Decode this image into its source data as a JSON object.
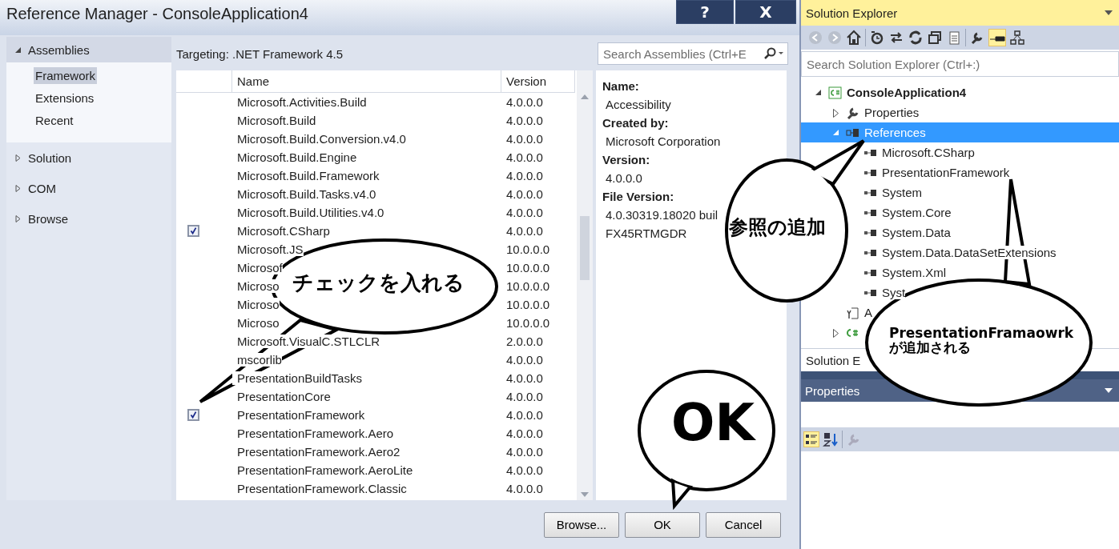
{
  "dialog": {
    "title": "Reference Manager - ConsoleApplication4",
    "title_buttons": [
      "?",
      "X"
    ],
    "nav": [
      {
        "label": "Assemblies",
        "expanded": true,
        "children": [
          {
            "label": "Framework",
            "selected": true
          },
          {
            "label": "Extensions",
            "selected": false
          },
          {
            "label": "Recent",
            "selected": false
          }
        ]
      },
      {
        "label": "Solution",
        "expanded": false
      },
      {
        "label": "COM",
        "expanded": false
      },
      {
        "label": "Browse",
        "expanded": false
      }
    ],
    "targeting": "Targeting: .NET Framework 4.5",
    "search": {
      "placeholder": "Search Assemblies (Ctrl+E"
    },
    "columns": [
      "Name",
      "Version"
    ],
    "rows": [
      {
        "name": "Microsoft.Activities.Build",
        "version": "4.0.0.0",
        "checked": false
      },
      {
        "name": "Microsoft.Build",
        "version": "4.0.0.0",
        "checked": false
      },
      {
        "name": "Microsoft.Build.Conversion.v4.0",
        "version": "4.0.0.0",
        "checked": false
      },
      {
        "name": "Microsoft.Build.Engine",
        "version": "4.0.0.0",
        "checked": false
      },
      {
        "name": "Microsoft.Build.Framework",
        "version": "4.0.0.0",
        "checked": false
      },
      {
        "name": "Microsoft.Build.Tasks.v4.0",
        "version": "4.0.0.0",
        "checked": false
      },
      {
        "name": "Microsoft.Build.Utilities.v4.0",
        "version": "4.0.0.0",
        "checked": false
      },
      {
        "name": "Microsoft.CSharp",
        "version": "4.0.0.0",
        "checked": true
      },
      {
        "name": "Microsoft.JS",
        "version": "10.0.0.0",
        "checked": false
      },
      {
        "name": "Microsof",
        "version": "10.0.0.0",
        "checked": false
      },
      {
        "name": "Microso",
        "version": "10.0.0.0",
        "checked": false
      },
      {
        "name": "Microso",
        "version": "10.0.0.0",
        "checked": false
      },
      {
        "name": "Microso",
        "version": "10.0.0.0",
        "checked": false
      },
      {
        "name": "Microsoft.VisualC.STLCLR",
        "version": "2.0.0.0",
        "checked": false
      },
      {
        "name": "mscorlib",
        "version": "4.0.0.0",
        "checked": false
      },
      {
        "name": "PresentationBuildTasks",
        "version": "4.0.0.0",
        "checked": false
      },
      {
        "name": "PresentationCore",
        "version": "4.0.0.0",
        "checked": false
      },
      {
        "name": "PresentationFramework",
        "version": "4.0.0.0",
        "checked": true
      },
      {
        "name": "PresentationFramework.Aero",
        "version": "4.0.0.0",
        "checked": false
      },
      {
        "name": "PresentationFramework.Aero2",
        "version": "4.0.0.0",
        "checked": false
      },
      {
        "name": "PresentationFramework.AeroLite",
        "version": "4.0.0.0",
        "checked": false
      },
      {
        "name": "PresentationFramework.Classic",
        "version": "4.0.0.0",
        "checked": false
      }
    ],
    "details": [
      {
        "label": "Name:",
        "value": "Accessibility"
      },
      {
        "label": "Created by:",
        "value": "Microsoft Corporation"
      },
      {
        "label": "Version:",
        "value": "4.0.0.0"
      },
      {
        "label": "File Version:",
        "value": "4.0.30319.18020 buil",
        "value2": "FX45RTMGDR"
      }
    ],
    "buttons": [
      "Browse...",
      "OK",
      "Cancel"
    ]
  },
  "solution_explorer": {
    "title": "Solution Explorer",
    "search": {
      "placeholder": "Search Solution Explorer (Ctrl+:)"
    },
    "tree": [
      {
        "kind": "project",
        "label": "ConsoleApplication4",
        "expanded": true,
        "selected": false,
        "children": [
          {
            "kind": "properties",
            "label": "Properties",
            "expanded": false,
            "selected": false
          },
          {
            "kind": "references",
            "label": "References",
            "expanded": true,
            "selected": true,
            "children": [
              {
                "kind": "reference",
                "label": "Microsoft.CSharp",
                "selected": false
              },
              {
                "kind": "reference",
                "label": "PresentationFramework",
                "selected": false
              },
              {
                "kind": "reference",
                "label": "System",
                "selected": false
              },
              {
                "kind": "reference",
                "label": "System.Core",
                "selected": false
              },
              {
                "kind": "reference",
                "label": "System.Data",
                "selected": false
              },
              {
                "kind": "reference",
                "label": "System.Data.DataSetExtensions",
                "selected": false
              },
              {
                "kind": "reference",
                "label": "System.Xml",
                "selected": false
              },
              {
                "kind": "reference",
                "label": "Syst",
                "selected": false
              }
            ]
          },
          {
            "kind": "config",
            "label": "A",
            "selected": false
          },
          {
            "kind": "cs-file",
            "expanded": false,
            "selected": false
          }
        ]
      }
    ],
    "tab": "Solution E"
  },
  "properties": {
    "title": "Properties"
  },
  "callouts": [
    "チェックを入れる",
    "参照の追加",
    "PresentationFramaowrk\nが追加される",
    "OK"
  ]
}
